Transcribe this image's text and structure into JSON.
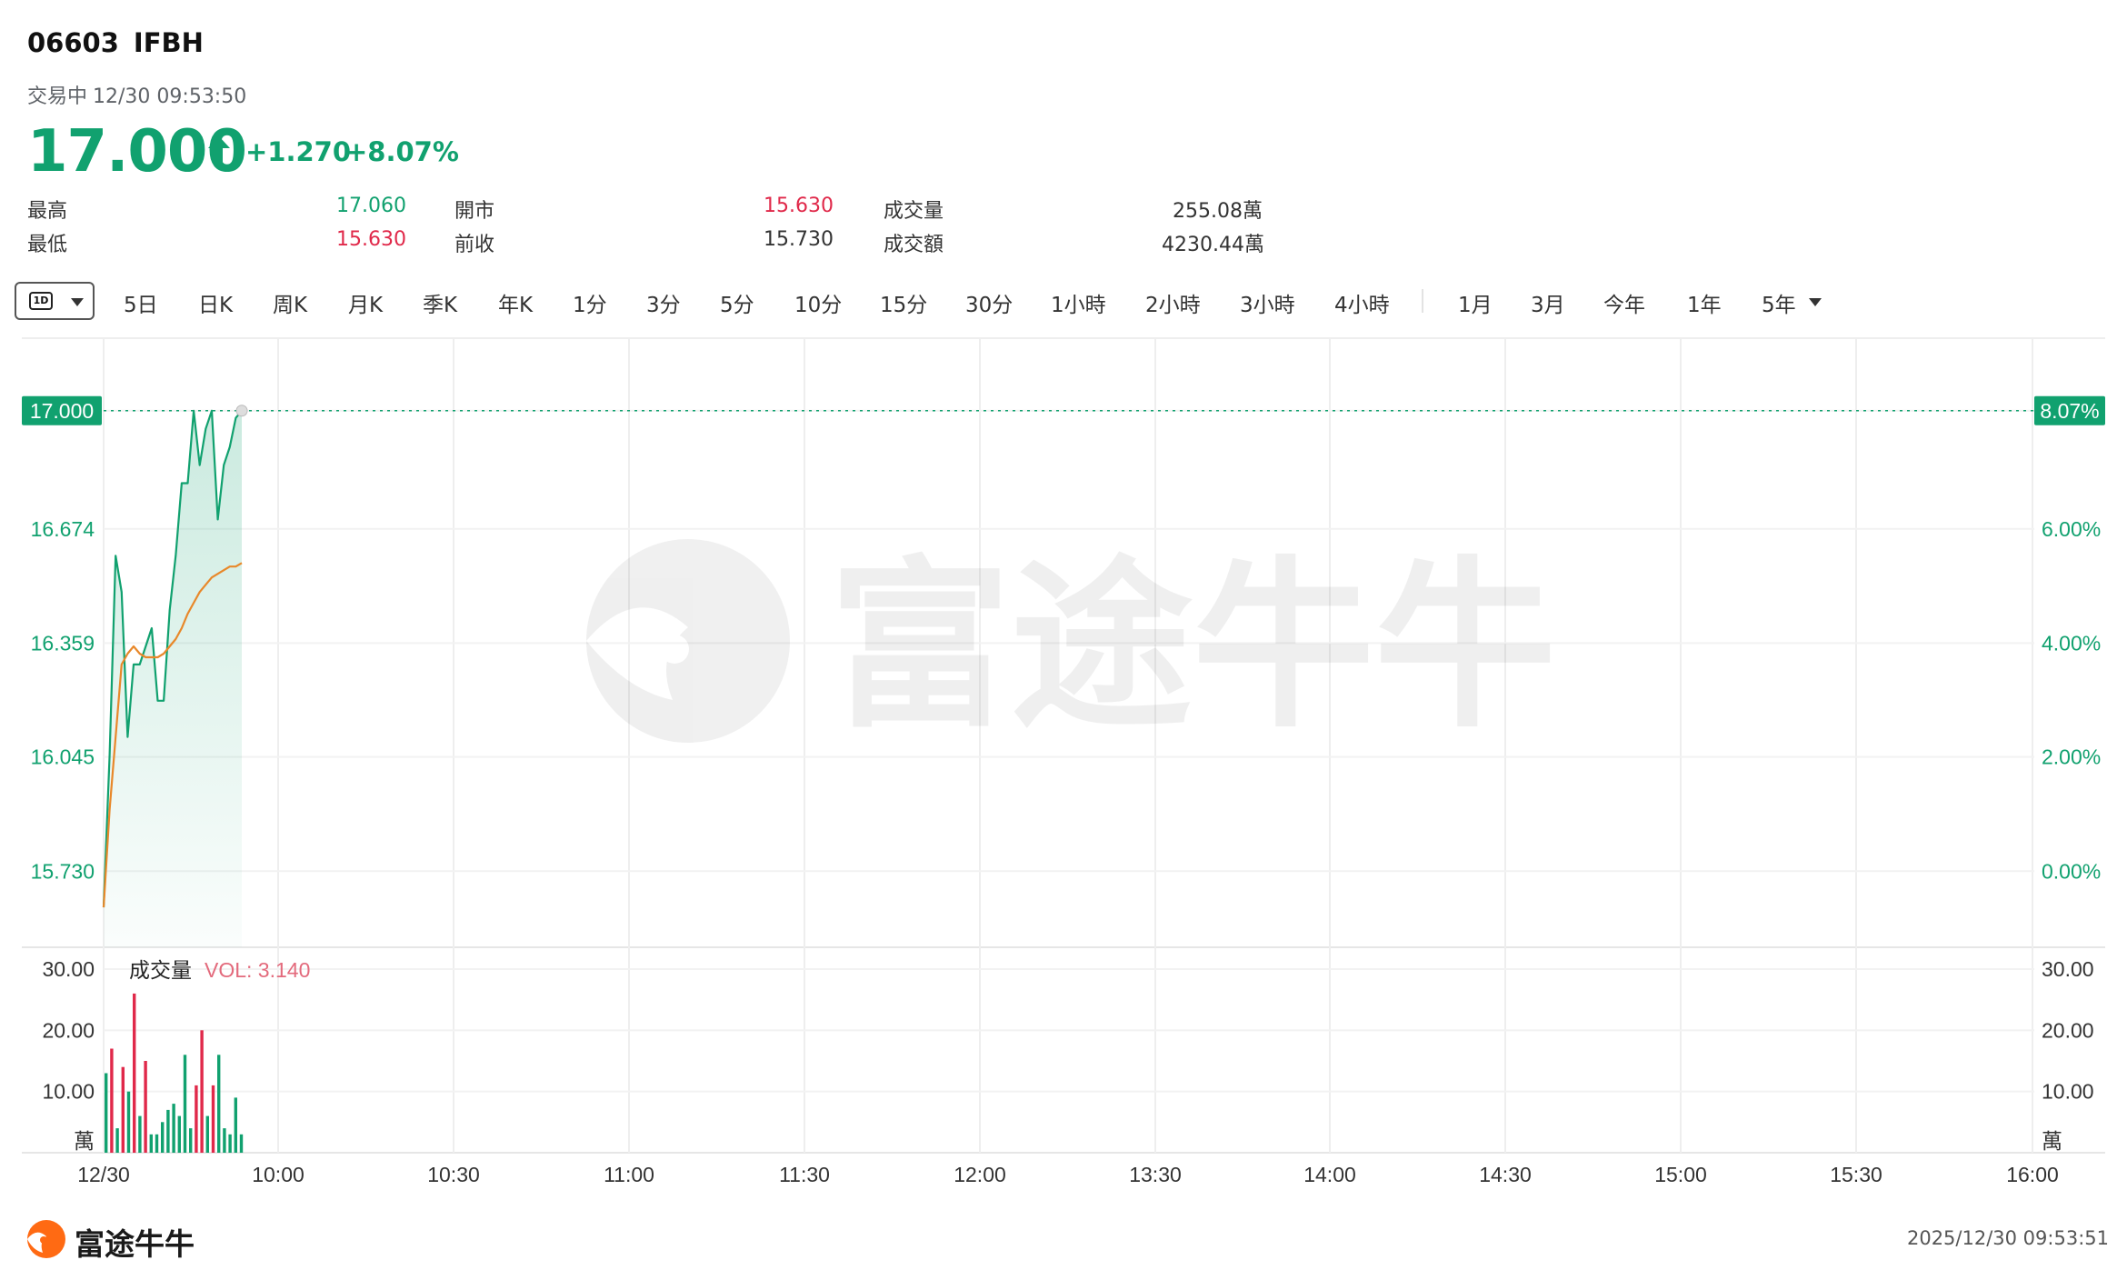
{
  "header": {
    "code": "06603",
    "ticker": "IFBH",
    "status": "交易中",
    "datetime": "12/30 09:53:50",
    "price": "17.000",
    "change": "+1.270",
    "change_pct": "+8.07%"
  },
  "stats": {
    "high_label": "最高",
    "high_value": "17.060",
    "low_label": "最低",
    "low_value": "15.630",
    "open_label": "開市",
    "open_value": "15.630",
    "prev_close_label": "前收",
    "prev_close_value": "15.730",
    "volume_label": "成交量",
    "volume_value": "255.08萬",
    "turnover_label": "成交額",
    "turnover_value": "4230.44萬"
  },
  "toolbar": {
    "selected_period": "1D",
    "tabs": [
      "5日",
      "日K",
      "周K",
      "月K",
      "季K",
      "年K",
      "1分",
      "3分",
      "5分",
      "10分",
      "15分",
      "30分",
      "1小時",
      "2小時",
      "3小時",
      "4小時",
      "1月",
      "3月",
      "今年",
      "1年",
      "5年"
    ]
  },
  "chart_data": [
    {
      "type": "line",
      "x_ticks": [
        "12/30",
        "10:00",
        "10:30",
        "11:00",
        "11:30",
        "12:00",
        "13:30",
        "14:00",
        "14:30",
        "15:00",
        "15:30",
        "16:00"
      ],
      "price_ticks": [
        "17.000",
        "16.674",
        "16.359",
        "16.045",
        "15.730"
      ],
      "pct_ticks": [
        "8.07%",
        "6.00%",
        "4.00%",
        "2.00%",
        "0.00%"
      ],
      "ylim": [
        15.52,
        17.2
      ],
      "prev_close": 15.73,
      "last_price": 17.0,
      "last_price_label": "17.000",
      "last_pct_label": "8.07%",
      "series": [
        {
          "values": [
            15.63,
            16.05,
            16.6,
            16.5,
            16.1,
            16.3,
            16.3,
            16.35,
            16.4,
            16.2,
            16.2,
            16.45,
            16.6,
            16.8,
            16.8,
            17.0,
            16.85,
            16.95,
            17.0,
            16.7,
            16.85,
            16.9,
            16.98,
            17.0
          ]
        },
        {
          "values": [
            15.63,
            15.9,
            16.1,
            16.3,
            16.33,
            16.35,
            16.33,
            16.32,
            16.32,
            16.32,
            16.33,
            16.35,
            16.37,
            16.4,
            16.44,
            16.47,
            16.5,
            16.52,
            16.54,
            16.55,
            16.56,
            16.57,
            16.57,
            16.58
          ]
        }
      ]
    },
    {
      "type": "bar",
      "title": "成交量",
      "vol_label": "VOL: 3.140",
      "y_ticks": [
        "30.00",
        "20.00",
        "10.00"
      ],
      "unit": "萬",
      "ylim": [
        0,
        30
      ],
      "values": [
        13,
        17,
        4,
        14,
        10,
        26,
        6,
        15,
        3,
        3,
        5,
        7,
        8,
        6,
        16,
        4,
        11,
        20,
        6,
        11,
        16,
        4,
        3,
        9,
        3
      ],
      "colors": [
        "g",
        "r",
        "g",
        "r",
        "g",
        "r",
        "g",
        "r",
        "g",
        "g",
        "g",
        "g",
        "g",
        "g",
        "g",
        "g",
        "r",
        "r",
        "g",
        "r",
        "g",
        "g",
        "g",
        "g",
        "g"
      ]
    }
  ],
  "watermark": "富途牛牛",
  "footer": {
    "logo_text": "富途牛牛",
    "timestamp": "2025/12/30 09:53:51"
  },
  "colors": {
    "up": "#11a16f",
    "down": "#e0294a",
    "avg_line": "#e8882a"
  }
}
